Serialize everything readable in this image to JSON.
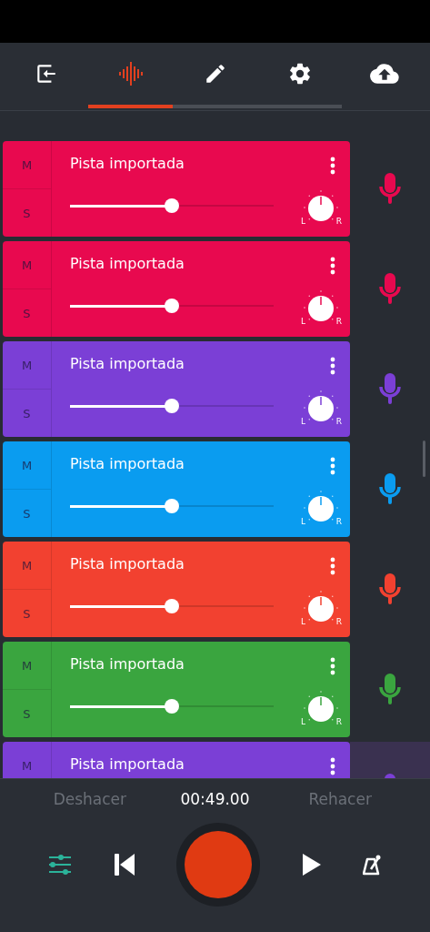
{
  "tabs": [
    {
      "kind": "import",
      "selected": false
    },
    {
      "kind": "waveform",
      "selected": true
    },
    {
      "kind": "edit",
      "selected": false
    },
    {
      "kind": "settings",
      "selected": false
    },
    {
      "kind": "upload",
      "selected": false
    }
  ],
  "tracks": [
    {
      "name": "Pista importada",
      "mute_label": "M",
      "solo_label": "S",
      "color": "#e8094f",
      "level": 0.5,
      "pan_left": "L",
      "pan_right": "R",
      "selected": false
    },
    {
      "name": "Pista importada",
      "mute_label": "M",
      "solo_label": "S",
      "color": "#e8094f",
      "level": 0.5,
      "pan_left": "L",
      "pan_right": "R",
      "selected": false
    },
    {
      "name": "Pista importada",
      "mute_label": "M",
      "solo_label": "S",
      "color": "#7b3fd6",
      "level": 0.5,
      "pan_left": "L",
      "pan_right": "R",
      "selected": false
    },
    {
      "name": "Pista importada",
      "mute_label": "M",
      "solo_label": "S",
      "color": "#0a9cf0",
      "level": 0.5,
      "pan_left": "L",
      "pan_right": "R",
      "selected": false
    },
    {
      "name": "Pista importada",
      "mute_label": "M",
      "solo_label": "S",
      "color": "#f24130",
      "level": 0.5,
      "pan_left": "L",
      "pan_right": "R",
      "selected": false
    },
    {
      "name": "Pista importada",
      "mute_label": "M",
      "solo_label": "S",
      "color": "#3aa53f",
      "level": 0.5,
      "pan_left": "L",
      "pan_right": "R",
      "selected": false
    },
    {
      "name": "Pista importada",
      "mute_label": "M",
      "color": "#7b3fd6",
      "selected": true
    }
  ],
  "transport": {
    "undo": "Deshacer",
    "time": "00:49.00",
    "redo": "Rehacer"
  }
}
